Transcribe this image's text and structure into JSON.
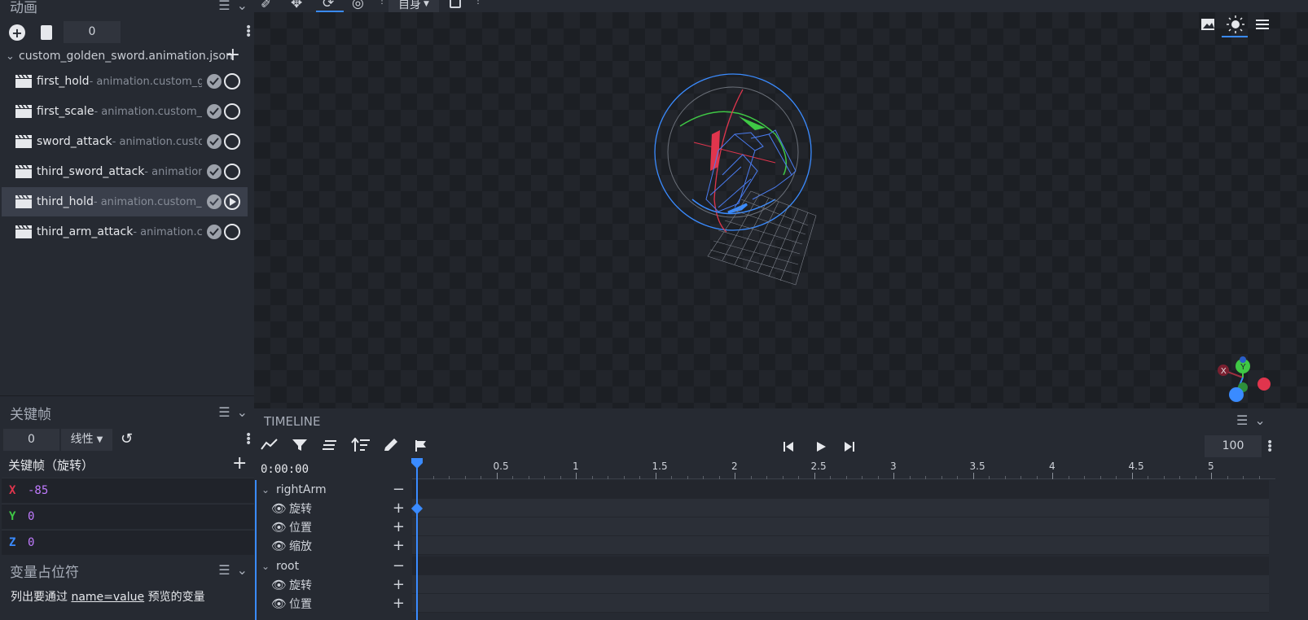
{
  "animation_panel": {
    "title": "动画",
    "frame_input": "0",
    "file": "custom_golden_sword.animation.json",
    "items": [
      {
        "name": "first_hold",
        "sub": " - animation.custom_golden_sword.first_hold",
        "state": "ring"
      },
      {
        "name": "first_scale",
        "sub": " - animation.custom_golden_sword.first_scale",
        "state": "ring"
      },
      {
        "name": "sword_attack",
        "sub": " - animation.custom_golden_sword.sword_attack",
        "state": "ring"
      },
      {
        "name": "third_sword_attack",
        "sub": " - animation.custom_golden_sword.third_sword_attack",
        "state": "ring"
      },
      {
        "name": "third_hold",
        "sub": " - animation.custom_golden_sword.third_hold",
        "state": "play"
      },
      {
        "name": "third_arm_attack",
        "sub": " - animation.custom_golden_sword.third_arm_attack",
        "state": "ring"
      }
    ]
  },
  "keyframe_panel": {
    "title": "关键帧",
    "frame_input": "0",
    "interpolation": "线性",
    "channel_title": "关键帧（旋转）",
    "rows": [
      {
        "axis": "X",
        "value": "-85",
        "color": "#e0354d"
      },
      {
        "axis": "Y",
        "value": "0",
        "color": "#3fc845"
      },
      {
        "axis": "Z",
        "value": "0",
        "color": "#3a8bff"
      }
    ]
  },
  "variables_panel": {
    "title": "变量占位符",
    "desc_a": "列出要通过",
    "desc_b": "name=value",
    "desc_c": "预览的变量"
  },
  "toolbar": {
    "space_label": "自身"
  },
  "timeline": {
    "title": "TIMELINE",
    "time": "0:00:00",
    "fps": "100",
    "ticks": [
      "0",
      "0.5",
      "1",
      "1.5",
      "2",
      "2.5",
      "3",
      "3.5",
      "4",
      "4.5",
      "5"
    ],
    "tracks": [
      {
        "label": "rightArm",
        "kind": "group"
      },
      {
        "label": "旋转",
        "kind": "channel",
        "keyframe_at": 0
      },
      {
        "label": "位置",
        "kind": "channel"
      },
      {
        "label": "缩放",
        "kind": "channel"
      },
      {
        "label": "root",
        "kind": "group"
      },
      {
        "label": "旋转",
        "kind": "channel"
      },
      {
        "label": "位置",
        "kind": "channel"
      }
    ]
  },
  "colors": {
    "accent": "#3a8bff",
    "x": "#e0354d",
    "y": "#3fc845",
    "z": "#3a8bff"
  }
}
